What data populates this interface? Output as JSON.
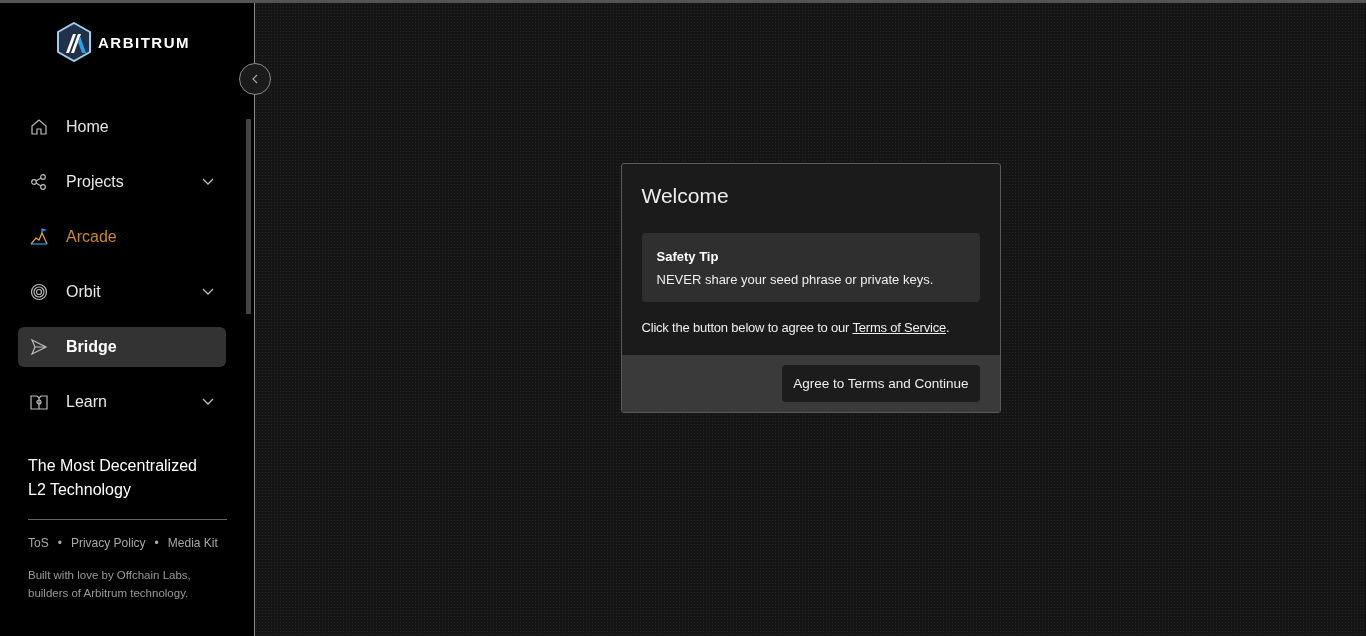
{
  "sidebar": {
    "logo_text": "ARBITRUM",
    "nav_items": [
      {
        "label": "Home",
        "expandable": false,
        "selected": false,
        "highlighted": false
      },
      {
        "label": "Projects",
        "expandable": true,
        "selected": false,
        "highlighted": false
      },
      {
        "label": "Arcade",
        "expandable": false,
        "selected": false,
        "highlighted": true
      },
      {
        "label": "Orbit",
        "expandable": true,
        "selected": false,
        "highlighted": false
      },
      {
        "label": "Bridge",
        "expandable": false,
        "selected": true,
        "highlighted": false
      },
      {
        "label": "Learn",
        "expandable": true,
        "selected": false,
        "highlighted": false
      }
    ],
    "tagline": "The Most Decentralized L2 Technology",
    "footer_links": [
      "ToS",
      "Privacy Policy",
      "Media Kit"
    ],
    "link_separator": "•",
    "credits": "Built with love by Offchain Labs, builders of Arbitrum technology."
  },
  "dialog": {
    "title": "Welcome",
    "tip": {
      "heading": "Safety Tip",
      "text": "NEVER share your seed phrase or private keys."
    },
    "message": "Click the button below to agree to our",
    "link": "Terms of Service",
    "message_end": ".",
    "button": "Agree to Terms and Continue"
  }
}
